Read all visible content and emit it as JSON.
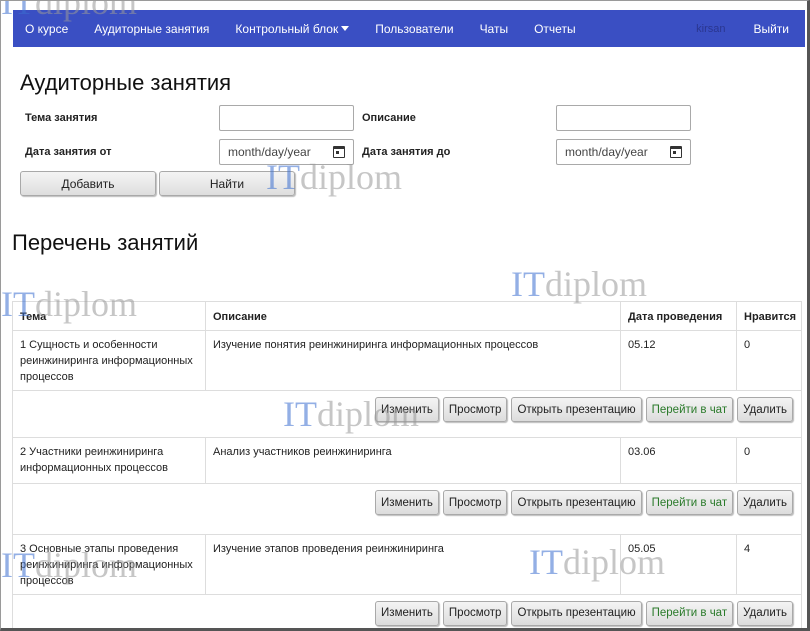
{
  "nav": {
    "items": [
      {
        "label": "О курсе"
      },
      {
        "label": "Аудиторные занятия"
      },
      {
        "label": "Контрольный блок"
      },
      {
        "label": "Пользователи"
      },
      {
        "label": "Чаты"
      },
      {
        "label": "Отчеты"
      }
    ],
    "user": "kirsan",
    "exit": "Выйти"
  },
  "form": {
    "title": "Аудиторные занятия",
    "topic_label": "Тема занятия",
    "desc_label": "Описание",
    "date_from_label": "Дата занятия от",
    "date_to_label": "Дата занятия до",
    "date_placeholder": "month/day/year",
    "add_label": "Добавить",
    "find_label": "Найти"
  },
  "list": {
    "title": "Перечень занятий",
    "headers": [
      "Тема",
      "Описание",
      "Дата проведения",
      "Нравится"
    ],
    "actions": [
      "Изменить",
      "Просмотр",
      "Открыть презентацию",
      "Перейти в чат",
      "Удалить"
    ],
    "rows": [
      {
        "topic": "1 Сущность и особенности реинжиниринга информационных процессов",
        "desc": "Изучение понятия реинжиниринга информационных процессов",
        "date": "05.12",
        "likes": "0"
      },
      {
        "topic": "2 Участники реинжиниринга информационных процессов",
        "desc": "Анализ участников реинжиниринга",
        "date": "03.06",
        "likes": "0"
      },
      {
        "topic": "3 Основные этапы проведения реинжиниринга информационных процессов",
        "desc": "Изучение этапов проведения реинжиниринга",
        "date": "05.05",
        "likes": "4"
      }
    ]
  },
  "watermark": {
    "it": "IT",
    "diplom": "diplom"
  }
}
